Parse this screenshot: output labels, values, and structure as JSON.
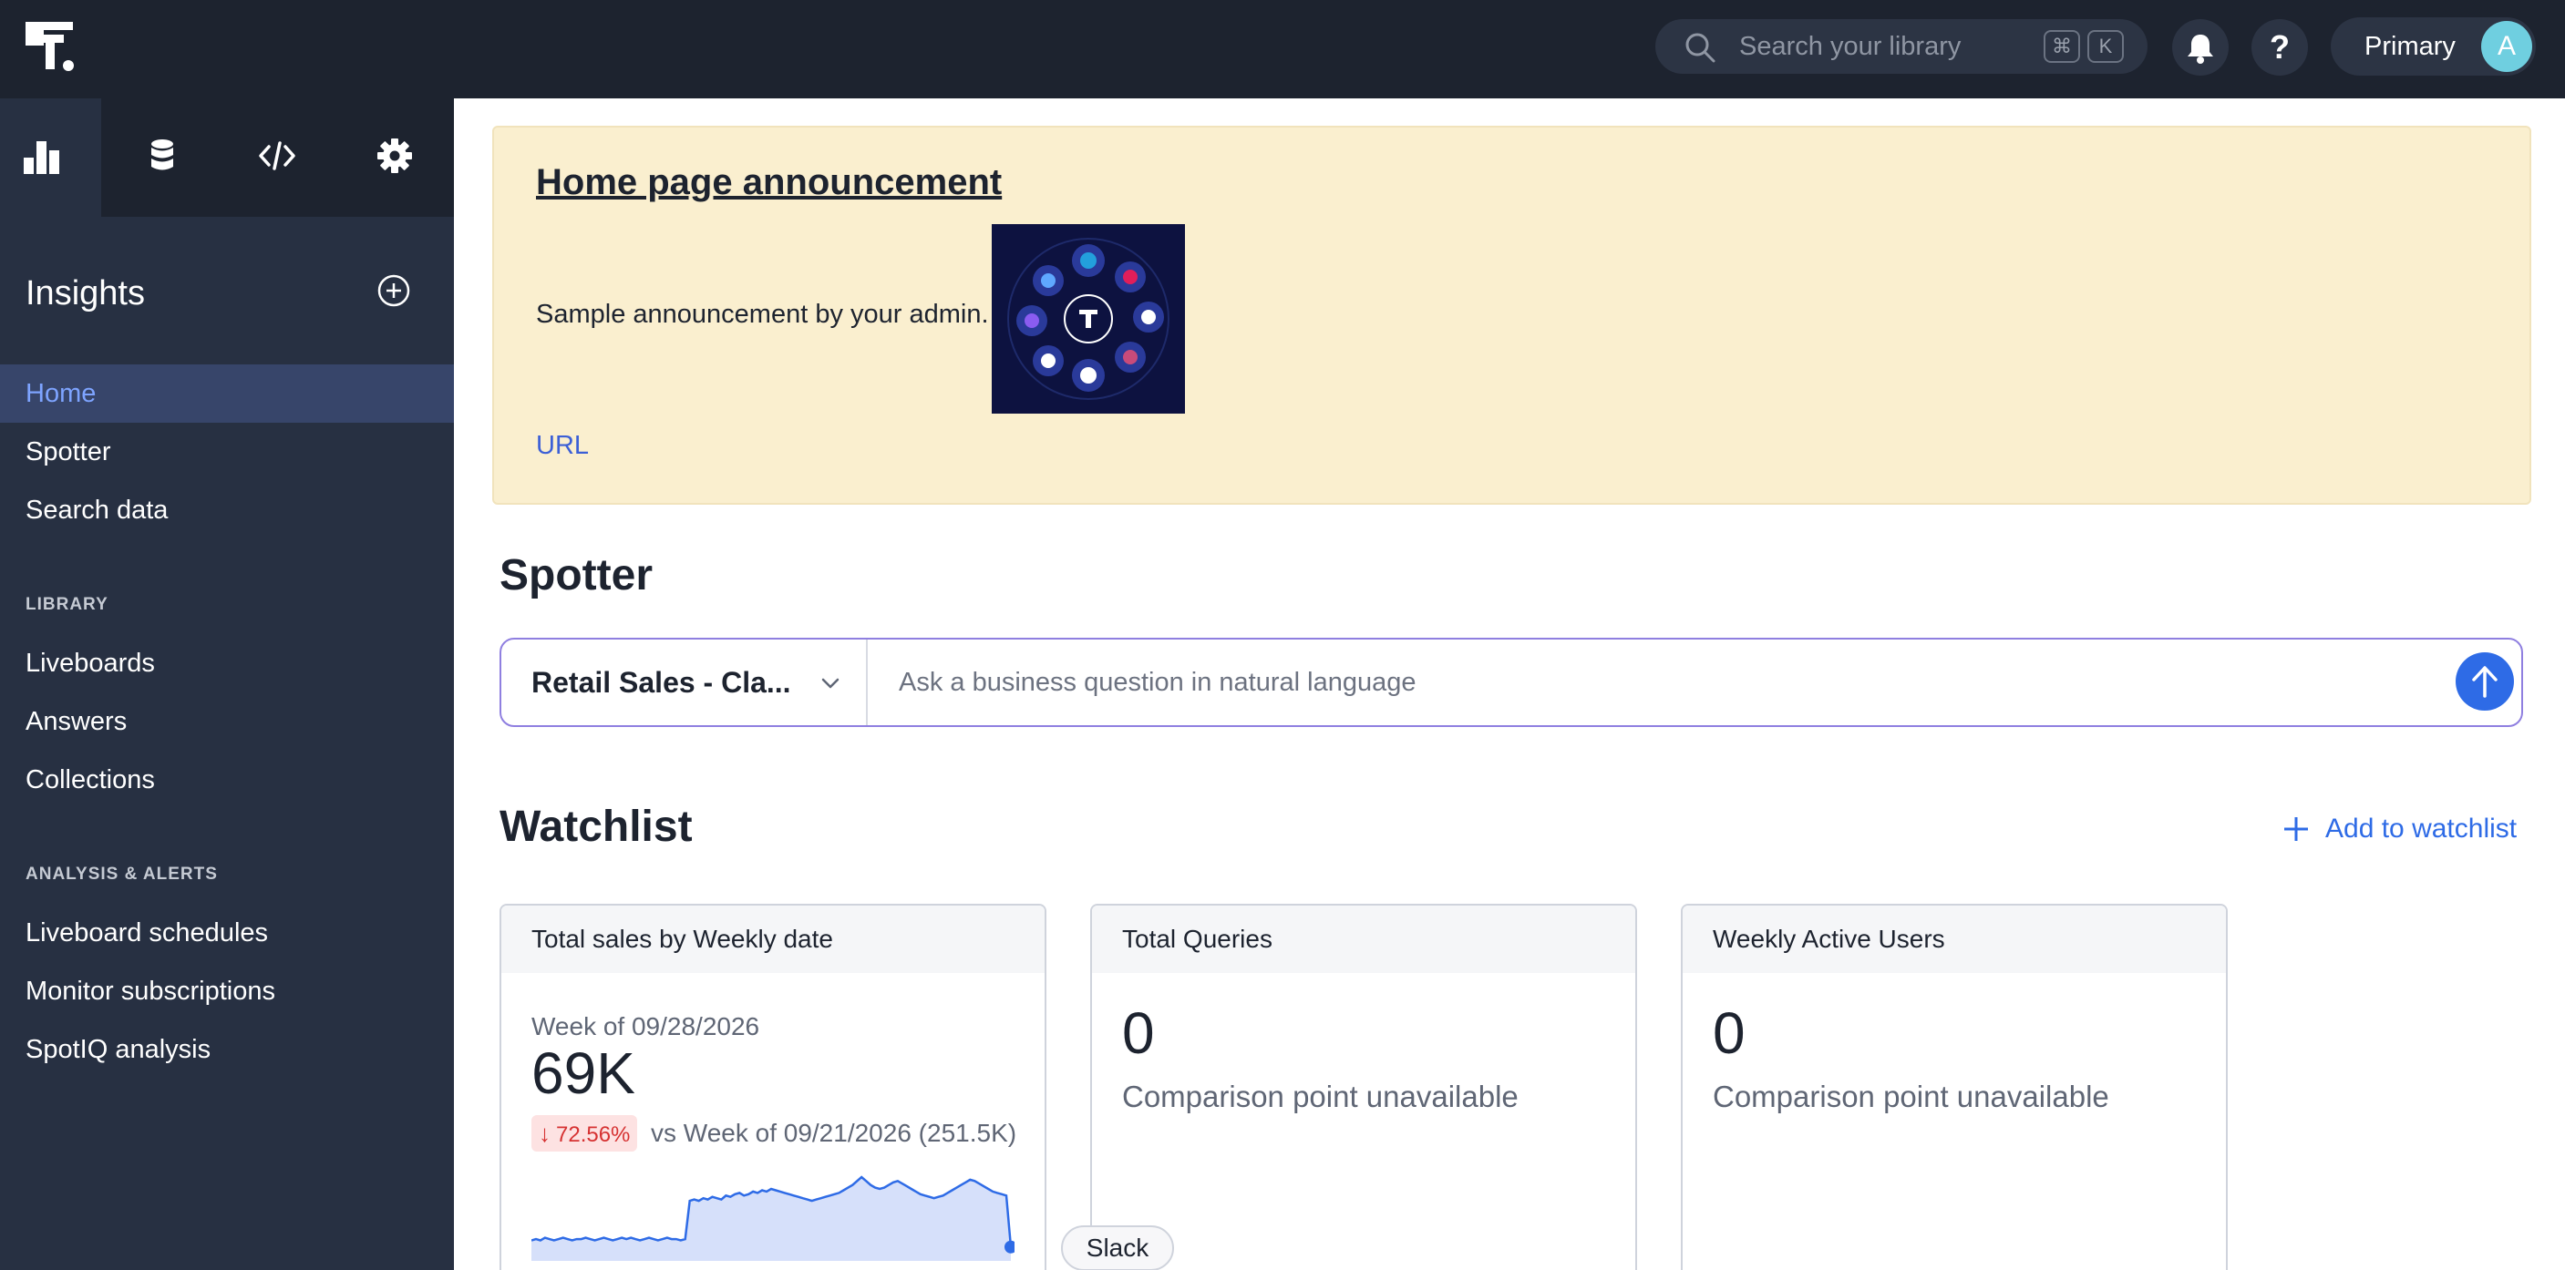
{
  "topbar": {
    "search_placeholder": "Search your library",
    "shortcut_keys": [
      "⌘",
      "K"
    ],
    "help_label": "?",
    "org_label": "Primary",
    "avatar_initial": "A"
  },
  "sidebar": {
    "title": "Insights",
    "primary_items": [
      {
        "label": "Home",
        "active": true
      },
      {
        "label": "Spotter",
        "active": false
      },
      {
        "label": "Search data",
        "active": false
      }
    ],
    "library_label": "LIBRARY",
    "library_items": [
      {
        "label": "Liveboards"
      },
      {
        "label": "Answers"
      },
      {
        "label": "Collections"
      }
    ],
    "analysis_label": "ANALYSIS & ALERTS",
    "analysis_items": [
      {
        "label": "Liveboard schedules"
      },
      {
        "label": "Monitor subscriptions"
      },
      {
        "label": "SpotIQ analysis"
      }
    ]
  },
  "announcement": {
    "title": "Home page announcement",
    "text": "Sample announcement by your admin.",
    "link": "URL"
  },
  "spotter": {
    "heading": "Spotter",
    "datasource": "Retail Sales - Cla...",
    "placeholder": "Ask a business question in natural language"
  },
  "watchlist": {
    "heading": "Watchlist",
    "add_label": "Add to watchlist",
    "cards": [
      {
        "title": "Total sales by Weekly date",
        "period": "Week of 09/28/2026",
        "value": "69K",
        "change": "72.56%",
        "change_direction": "down",
        "comparison": "vs Week of 09/21/2026 (251.5K)"
      },
      {
        "title": "Total Queries",
        "value": "0",
        "comparison": "Comparison point unavailable"
      },
      {
        "title": "Weekly Active Users",
        "value": "0",
        "comparison": "Comparison point unavailable"
      }
    ]
  },
  "tooltip_chip": "Slack",
  "colors": {
    "topbar_bg": "#1d232f",
    "sidebar_bg": "#273042",
    "active_nav_bg": "#37456a",
    "active_nav_text": "#7ea4ff",
    "announcement_bg": "#faefcf",
    "accent_blue": "#2e6be6",
    "negative_red": "#d63232"
  },
  "sparkline": {
    "values": [
      10,
      11,
      10,
      12,
      11,
      10,
      11,
      12,
      11,
      10,
      11,
      11,
      12,
      11,
      10,
      11,
      12,
      11,
      10,
      11,
      12,
      11,
      12,
      11,
      10,
      11,
      12,
      11,
      10,
      11,
      12,
      11,
      11,
      10,
      11,
      40,
      41,
      40,
      42,
      41,
      43,
      42,
      41,
      44,
      43,
      45,
      46,
      44,
      45,
      47,
      46,
      48,
      47,
      49,
      48,
      47,
      46,
      45,
      44,
      43,
      42,
      41,
      40,
      41,
      42,
      43,
      44,
      45,
      46,
      48,
      50,
      52,
      55,
      58,
      55,
      52,
      50,
      49,
      50,
      52,
      54,
      55,
      53,
      51,
      49,
      47,
      45,
      44,
      43,
      42,
      43,
      44,
      46,
      48,
      50,
      52,
      54,
      56,
      55,
      53,
      51,
      49,
      47,
      46,
      45,
      44,
      5
    ]
  }
}
